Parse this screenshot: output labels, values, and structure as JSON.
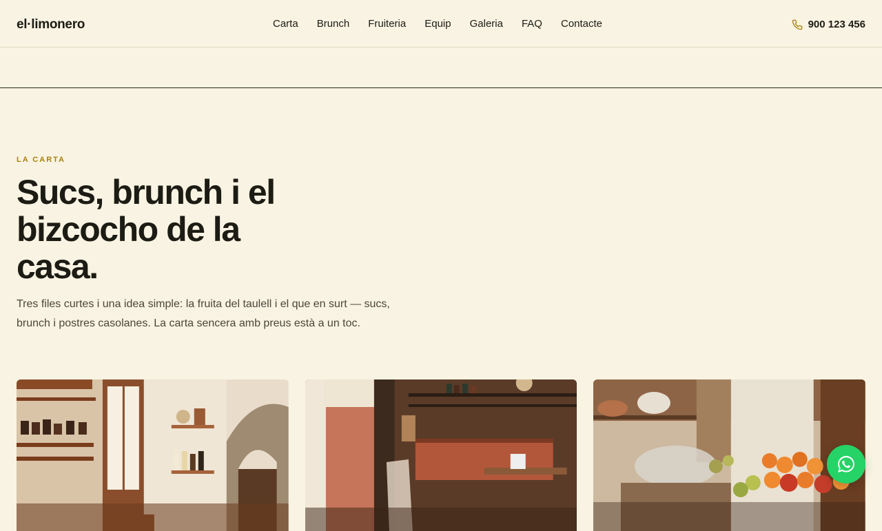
{
  "header": {
    "logo": "el·limonero",
    "nav": [
      "Carta",
      "Brunch",
      "Fruiteria",
      "Equip",
      "Galeria",
      "FAQ",
      "Contacte"
    ],
    "phone": "900 123 456",
    "phone_icon": "phone-icon"
  },
  "section": {
    "eyebrow": "LA CARTA",
    "title": "Sucs, brunch i el bizcocho de la casa.",
    "lede": "Tres files curtes i una idea simple: la fruita del taulell i el que en surt — sucs, brunch i postres casolanes. La carta sencera amb preus està a un toc."
  },
  "cards": [
    "card-1",
    "card-2",
    "card-3"
  ],
  "whatsapp": {
    "icon": "whatsapp-icon"
  },
  "colors": {
    "background": "#f8f3e2",
    "accent": "#a8820e",
    "text": "#1c1b14",
    "whatsapp": "#25d366"
  }
}
